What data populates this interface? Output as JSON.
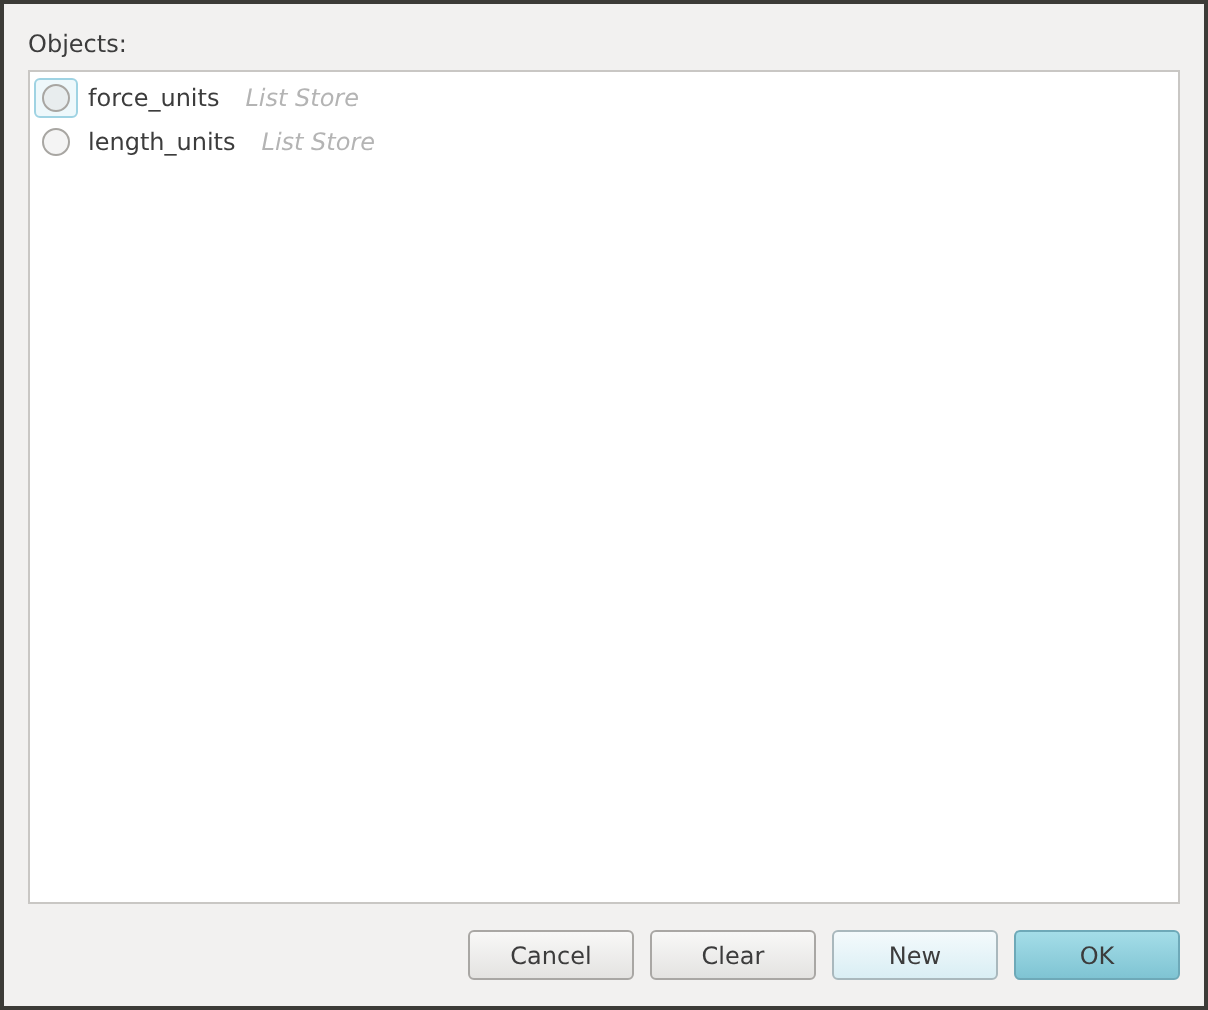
{
  "label": "Objects:",
  "objects": [
    {
      "name": "force_units",
      "type": "List Store",
      "selected": false,
      "focused": true
    },
    {
      "name": "length_units",
      "type": "List Store",
      "selected": false,
      "focused": false
    }
  ],
  "buttons": [
    {
      "label": "Cancel",
      "kind": "normal"
    },
    {
      "label": "Clear",
      "kind": "normal"
    },
    {
      "label": "New",
      "kind": "hover"
    },
    {
      "label": "OK",
      "kind": "default"
    }
  ]
}
